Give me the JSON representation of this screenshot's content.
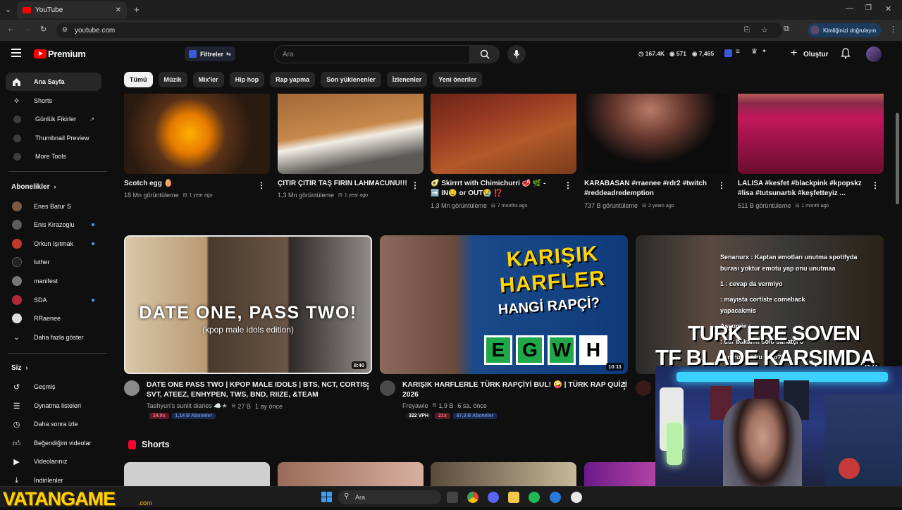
{
  "browser": {
    "tab_title": "YouTube",
    "url": "youtube.com",
    "verify_label": "Kimliğinizi doğrulayın"
  },
  "header": {
    "logo_text": "Premium",
    "filters_label": "Filtreler",
    "search_placeholder": "Ara",
    "stats": [
      "167.4K",
      "571",
      "7,465"
    ],
    "create_label": "Oluştur"
  },
  "sidebar": {
    "top_items": [
      {
        "label": "Ana Sayfa",
        "icon": "home-icon"
      },
      {
        "label": "Shorts",
        "icon": "shorts-icon"
      },
      {
        "label": "Günlük Fikirler",
        "icon": "extension-icon"
      },
      {
        "label": "Thumbnail Preview",
        "icon": "extension-icon"
      },
      {
        "label": "More Tools",
        "icon": "extension-icon"
      }
    ],
    "subs_heading": "Abonelikler",
    "subscriptions": [
      {
        "label": "Enes Batur S",
        "color": "#7a5a44",
        "dot": false
      },
      {
        "label": "Enis Kirazoglu",
        "color": "#5c5c5c",
        "dot": true
      },
      {
        "label": "Orkun Işıtmak",
        "color": "#c0392b",
        "dot": true
      },
      {
        "label": "luther",
        "color": "#222222",
        "dot": false
      },
      {
        "label": "manifest",
        "color": "#777777",
        "dot": false
      },
      {
        "label": "SDA",
        "color": "#b0283a",
        "dot": true
      },
      {
        "label": "RRaenee",
        "color": "#dddddd",
        "dot": false
      }
    ],
    "show_more": "Daha fazla göster",
    "you_heading": "Siz",
    "you_items": [
      {
        "label": "Geçmiş",
        "icon": "history-icon"
      },
      {
        "label": "Oynatma listeleri",
        "icon": "playlist-icon"
      },
      {
        "label": "Daha sonra izle",
        "icon": "clock-icon"
      },
      {
        "label": "Beğendiğim videolar",
        "icon": "like-icon"
      },
      {
        "label": "Videolarınız",
        "icon": "video-icon"
      },
      {
        "label": "İndirilenler",
        "icon": "download-icon"
      }
    ]
  },
  "chips": [
    "Tümü",
    "Müzik",
    "Mix'ler",
    "Hip hop",
    "Rap yapma",
    "Son yüklenenler",
    "İzlenenler",
    "Yeni öneriler"
  ],
  "row1": [
    {
      "title": "Scotch egg 🥚",
      "title2": "",
      "views": "18 Mn görüntüleme",
      "age": "1 year ago"
    },
    {
      "title": "ÇITIR ÇITIR TAŞ FIRIN LAHMACUNU!!!",
      "title2": "",
      "views": "1,3 Mn görüntüleme",
      "age": "1 year ago"
    },
    {
      "title": "🥑 Skirrrt with Chimichurri 🥩 🌿 -",
      "title2": "➡️ IN🤤 or OUT😭 ⁉️",
      "views": "1,3 Mn görüntüleme",
      "age": "7 months ago"
    },
    {
      "title": "KARABASAN #rraenee #rdr2 #twitch",
      "title2": "#reddeadredemption",
      "views": "737 B görüntüleme",
      "age": "2 years ago"
    },
    {
      "title": "LALISA #kesfet #blackpink #kpopskz",
      "title2": "#lisa #tutsunartık #keşfetteyiz ...",
      "views": "511 B görüntüleme",
      "age": "1 month ago"
    }
  ],
  "row2": [
    {
      "title": "DATE ONE PASS TWO | KPOP MALE IDOLS | BTS, NCT, CORTIS,",
      "title2": "SVT, ATEEZ, ENHYPEN, TWS, BND, RIIZE, &TEAM",
      "channel": "Taehyun's sunlit diaries ☁️★",
      "views": "27 B",
      "age": "1 ay önce",
      "duration": "8:40",
      "thumb_text": "DATE ONE, PASS TWO!",
      "thumb_sub": "(kpop male idols edition)",
      "badges": [
        "24.9x",
        "1,14 B Aboneler"
      ]
    },
    {
      "title": "KARIŞIK HARFLERLE TÜRK RAPÇİYİ BUL! 🤪 | TÜRK RAP QUİZİ",
      "title2": "2026",
      "channel": "Freyawie",
      "views": "1,9 B",
      "age": "6 sa. önce",
      "duration": "10:11",
      "thumb_line1": "KARIŞIK",
      "thumb_line2": "HARFLER",
      "thumb_line3": "HANGİ RAPÇİ?",
      "thumb_letters": [
        "E",
        "G",
        "W",
        "H"
      ],
      "badges": [
        "322 VPH",
        "21x",
        "87,3 B Aboneler"
      ]
    },
    {
      "duration": "47:44",
      "thumb_big1": "TURK ERE SOVEN",
      "thumb_big2": "TF BLADE KARŞIMDA",
      "chat": [
        "Senanurx : Kaptan emotları unutma spotifyda",
        "burası yoktur emotu yap onu unutmaa",
        "1  : cevap da vermiyo",
        ": mayısta cortiste comeback",
        "yapacakmis",
        "Asyumie : ",
        ": dur bakalım solo sanatçı o",
        "ben zulali : bu solo??"
      ]
    }
  ],
  "shorts_heading": "Shorts",
  "taskbar": {
    "search_label": "Ara",
    "watermark": "VATANGAME",
    "watermark_sub": ".com"
  }
}
